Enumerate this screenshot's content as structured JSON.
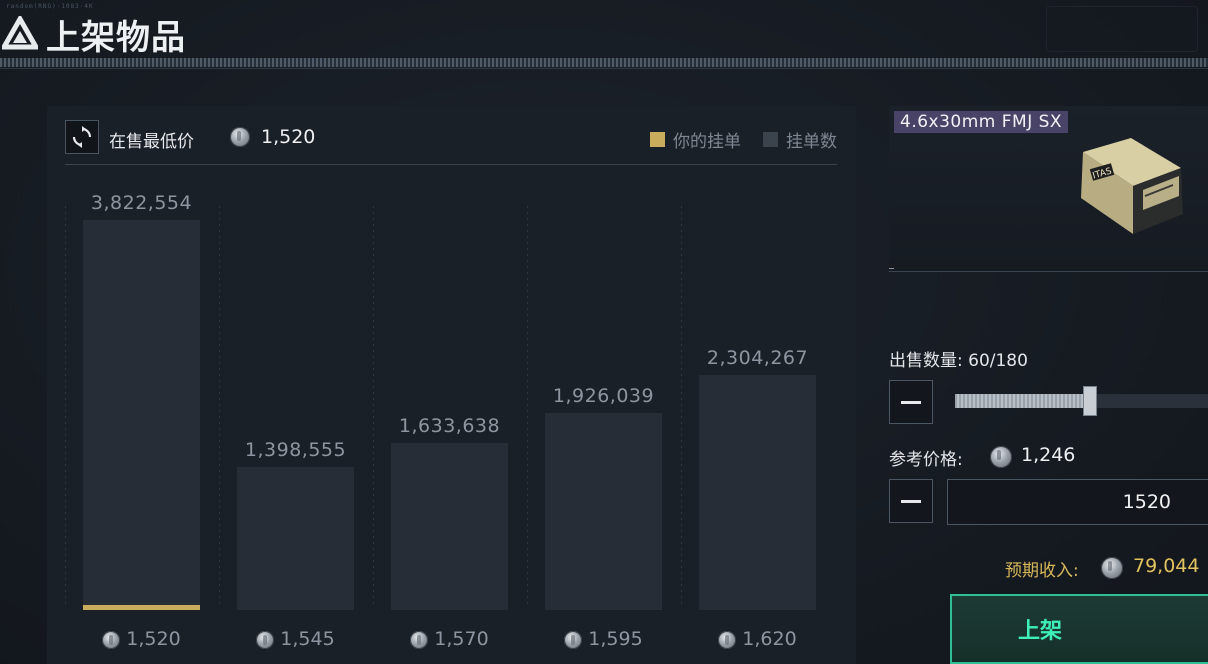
{
  "header": {
    "title": "上架物品",
    "tiny_text": "random(RNG)·1083·4K"
  },
  "chart_panel": {
    "lowest_label": "在售最低价",
    "lowest_value": "1,520",
    "legend_yours": "你的挂单",
    "legend_count": "挂单数",
    "bars": [
      {
        "count": "3,822,554",
        "price": "1,520"
      },
      {
        "count": "1,398,555",
        "price": "1,545"
      },
      {
        "count": "1,633,638",
        "price": "1,570"
      },
      {
        "count": "1,926,039",
        "price": "1,595"
      },
      {
        "count": "2,304,267",
        "price": "1,620"
      }
    ]
  },
  "chart_data": {
    "type": "bar",
    "categories": [
      "1,520",
      "1,545",
      "1,570",
      "1,595",
      "1,620"
    ],
    "values": [
      3822554,
      1398555,
      1633638,
      1926039,
      2304267
    ],
    "ylim": [
      0,
      3822554
    ],
    "legend": [
      "你的挂单",
      "挂单数"
    ],
    "highlight_index": 0,
    "highlight_color": "#c9ad5c",
    "bar_color": "#262d37"
  },
  "item": {
    "name": "4.6x30mm FMJ SX",
    "tag_color": "#4a4368",
    "image_text": "ITAS"
  },
  "sell": {
    "qty_label": "出售数量: 60/180",
    "qty_fraction": 0.333,
    "ref_label": "参考价格:",
    "ref_value": "1,246",
    "price_input": "1520",
    "income_label": "预期收入:",
    "income_value": "79,044",
    "list_button": "上架"
  },
  "colors": {
    "gold": "#c9ad5c",
    "green": "#3ef0b8",
    "background": "#161b22"
  }
}
